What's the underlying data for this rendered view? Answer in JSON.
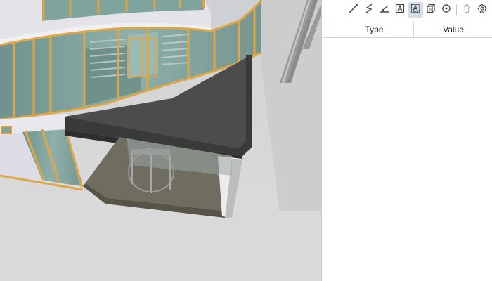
{
  "toolbar": {
    "tools": [
      {
        "name": "line-measure-icon",
        "active": false
      },
      {
        "name": "polyline-measure-icon",
        "active": false
      },
      {
        "name": "angle-measure-icon",
        "active": false
      },
      {
        "name": "text-annotation-icon",
        "active": false
      },
      {
        "name": "text-area-icon",
        "active": true
      },
      {
        "name": "box-icon",
        "active": false
      },
      {
        "name": "point-target-icon",
        "active": false
      },
      {
        "name": "trash-icon",
        "active": false
      },
      {
        "name": "settings-gear-icon",
        "active": false
      }
    ]
  },
  "table": {
    "type_header": "Type",
    "value_header": "Value",
    "rows": []
  },
  "colors": {
    "viewport_background": "#d7d7d7",
    "glass": "#7e9e98",
    "mullion": "#e0a645",
    "canopy": "#4b4b4b",
    "active_tool": "#d4dce6"
  }
}
